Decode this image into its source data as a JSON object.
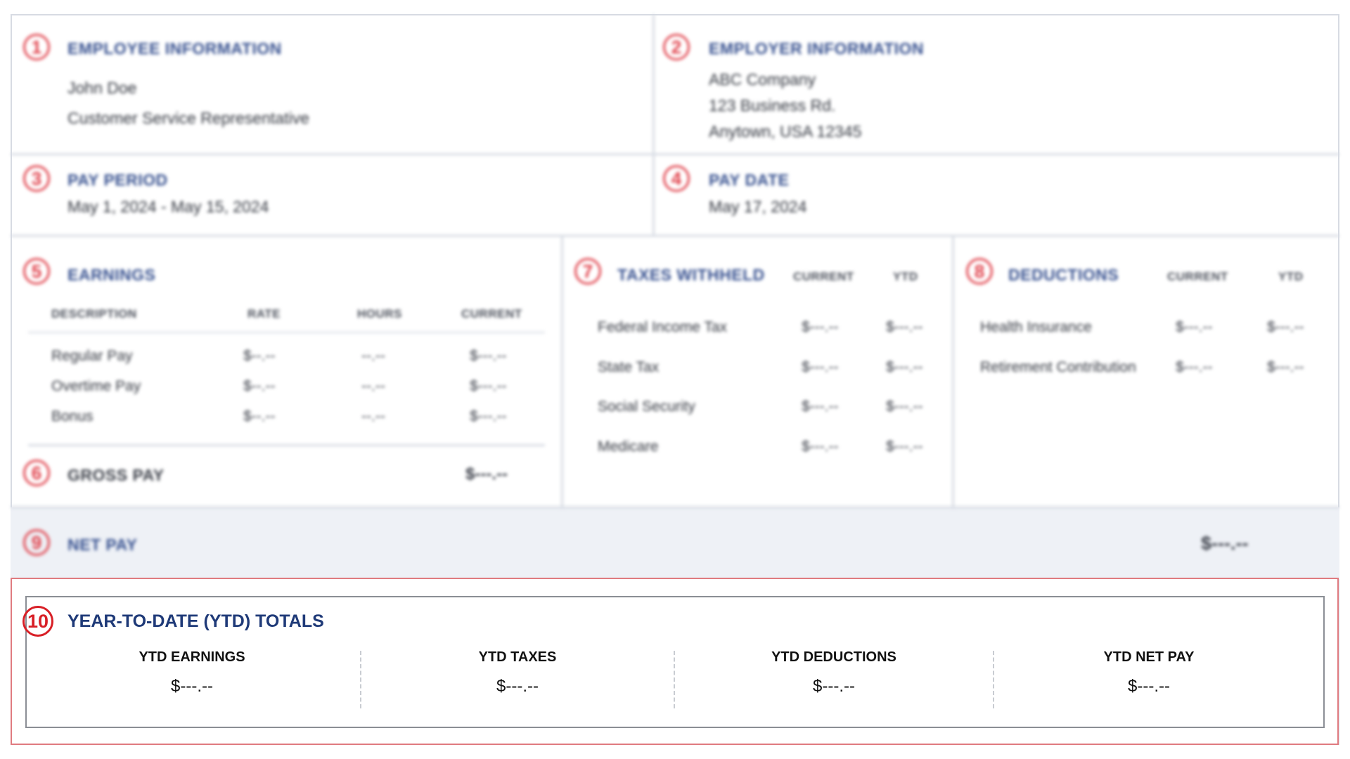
{
  "employee": {
    "num": "1",
    "title": "EMPLOYEE INFORMATION",
    "name": "John Doe",
    "position": "Customer Service Representative"
  },
  "employer": {
    "num": "2",
    "title": "EMPLOYER INFORMATION",
    "company": "ABC Company",
    "address1": "123 Business Rd.",
    "address2": "Anytown, USA 12345"
  },
  "pay_period": {
    "num": "3",
    "title": "PAY PERIOD",
    "value": "May 1, 2024 - May 15, 2024"
  },
  "pay_date": {
    "num": "4",
    "title": "PAY DATE",
    "value": "May 17, 2024"
  },
  "earnings": {
    "num": "5",
    "title": "EARNINGS",
    "headers": [
      "DESCRIPTION",
      "RATE",
      "HOURS",
      "CURRENT"
    ],
    "rows": [
      {
        "description": "Regular Pay",
        "rate": "$--.--",
        "hours": "--.--",
        "current": "$---.--"
      },
      {
        "description": "Overtime Pay",
        "rate": "$--.--",
        "hours": "--.--",
        "current": "$---.--"
      },
      {
        "description": "Bonus",
        "rate": "$--.--",
        "hours": "--.--",
        "current": "$---.--"
      }
    ]
  },
  "gross_pay": {
    "num": "6",
    "title": "GROSS PAY",
    "value": "$---.--"
  },
  "taxes": {
    "num": "7",
    "title": "TAXES WITHHELD",
    "headers": [
      "CURRENT",
      "YTD"
    ],
    "rows": [
      {
        "name": "Federal Income Tax",
        "current": "$---.--",
        "ytd": "$---.--"
      },
      {
        "name": "State Tax",
        "current": "$---.--",
        "ytd": "$---.--"
      },
      {
        "name": "Social Security",
        "current": "$---.--",
        "ytd": "$---.--"
      },
      {
        "name": "Medicare",
        "current": "$---.--",
        "ytd": "$---.--"
      }
    ]
  },
  "deductions": {
    "num": "8",
    "title": "DEDUCTIONS",
    "headers": [
      "CURRENT",
      "YTD"
    ],
    "rows": [
      {
        "name": "Health Insurance",
        "current": "$---.--",
        "ytd": "$---.--"
      },
      {
        "name": "Retirement Contribution",
        "current": "$---.--",
        "ytd": "$---.--"
      }
    ]
  },
  "net_pay": {
    "num": "9",
    "title": "NET PAY",
    "value": "$---.--"
  },
  "ytd": {
    "num": "10",
    "title": "YEAR-TO-DATE (YTD) TOTALS",
    "columns": [
      {
        "label": "YTD EARNINGS",
        "value": "$---.--"
      },
      {
        "label": "YTD TAXES",
        "value": "$---.--"
      },
      {
        "label": "YTD DEDUCTIONS",
        "value": "$---.--"
      },
      {
        "label": "YTD NET PAY",
        "value": "$---.--"
      }
    ]
  },
  "colors": {
    "accent_red": "#d81f26",
    "heading_blue": "#1f3a78",
    "band_bg": "#eef1f6"
  }
}
